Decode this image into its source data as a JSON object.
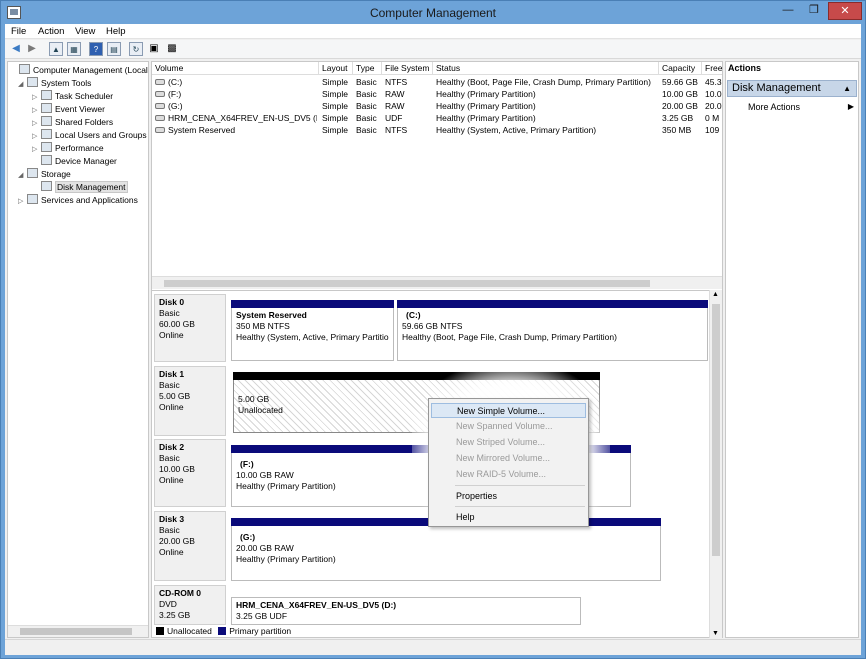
{
  "window": {
    "title": "Computer Management"
  },
  "menubar": [
    "File",
    "Action",
    "View",
    "Help"
  ],
  "tree": [
    {
      "label": "Computer Management (Local",
      "indent": 0,
      "arrow": "",
      "icon": "computer-icon"
    },
    {
      "label": "System Tools",
      "indent": 1,
      "arrow": "◢",
      "icon": "tools-icon"
    },
    {
      "label": "Task Scheduler",
      "indent": 2,
      "arrow": "▷",
      "icon": "clock-icon"
    },
    {
      "label": "Event Viewer",
      "indent": 2,
      "arrow": "▷",
      "icon": "event-viewer-icon"
    },
    {
      "label": "Shared Folders",
      "indent": 2,
      "arrow": "▷",
      "icon": "folder-icon"
    },
    {
      "label": "Local Users and Groups",
      "indent": 2,
      "arrow": "▷",
      "icon": "users-icon"
    },
    {
      "label": "Performance",
      "indent": 2,
      "arrow": "▷",
      "icon": "performance-icon"
    },
    {
      "label": "Device Manager",
      "indent": 2,
      "arrow": "",
      "icon": "device-manager-icon"
    },
    {
      "label": "Storage",
      "indent": 1,
      "arrow": "◢",
      "icon": "storage-icon"
    },
    {
      "label": "Disk Management",
      "indent": 2,
      "arrow": "",
      "icon": "disk-icon",
      "selected": true
    },
    {
      "label": "Services and Applications",
      "indent": 1,
      "arrow": "▷",
      "icon": "services-icon"
    }
  ],
  "volume_list": {
    "columns": [
      "Volume",
      "Layout",
      "Type",
      "File System",
      "Status",
      "Capacity",
      "Free"
    ],
    "rows": [
      [
        "(C:)",
        "Simple",
        "Basic",
        "NTFS",
        "Healthy (Boot, Page File, Crash Dump, Primary Partition)",
        "59.66 GB",
        "45.3"
      ],
      [
        "(F:)",
        "Simple",
        "Basic",
        "RAW",
        "Healthy (Primary Partition)",
        "10.00 GB",
        "10.0"
      ],
      [
        "(G:)",
        "Simple",
        "Basic",
        "RAW",
        "Healthy (Primary Partition)",
        "20.00 GB",
        "20.0"
      ],
      [
        "HRM_CENA_X64FREV_EN-US_DV5 (D:)",
        "Simple",
        "Basic",
        "UDF",
        "Healthy (Primary Partition)",
        "3.25 GB",
        "0 M"
      ],
      [
        "System Reserved",
        "Simple",
        "Basic",
        "NTFS",
        "Healthy (System, Active, Primary Partition)",
        "350 MB",
        "109"
      ]
    ]
  },
  "disks": [
    {
      "name": "Disk 0",
      "type": "Basic",
      "size": "60.00 GB",
      "state": "Online",
      "partitions": [
        {
          "name": "System Reserved",
          "line2": "350 MB NTFS",
          "line3": "Healthy (System, Active, Primary Partitio"
        },
        {
          "name": "(C:)",
          "line2": "59.66 GB NTFS",
          "line3": "Healthy (Boot, Page File, Crash Dump, Primary Partition)"
        }
      ]
    },
    {
      "name": "Disk 1",
      "type": "Basic",
      "size": "5.00 GB",
      "state": "Online",
      "partitions": [
        {
          "name": "",
          "line2": "5.00 GB",
          "line3": "Unallocated"
        }
      ]
    },
    {
      "name": "Disk 2",
      "type": "Basic",
      "size": "10.00 GB",
      "state": "Online",
      "partitions": [
        {
          "name": "(F:)",
          "line2": "10.00 GB RAW",
          "line3": "Healthy (Primary Partition)"
        }
      ]
    },
    {
      "name": "Disk 3",
      "type": "Basic",
      "size": "20.00 GB",
      "state": "Online",
      "partitions": [
        {
          "name": "(G:)",
          "line2": "20.00 GB RAW",
          "line3": "Healthy (Primary Partition)"
        }
      ]
    },
    {
      "name": "CD-ROM 0",
      "type": "DVD",
      "size": "3.25 GB",
      "state": "",
      "partitions": [
        {
          "name": "HRM_CENA_X64FREV_EN-US_DV5 (D:)",
          "line2": "3.25 GB UDF",
          "line3": ""
        }
      ]
    }
  ],
  "legend": {
    "unallocated": "Unallocated",
    "primary": "Primary partition"
  },
  "actions": {
    "header": "Actions",
    "section": "Disk Management",
    "item": "More Actions"
  },
  "context_menu": [
    {
      "label": "New Simple Volume...",
      "state": "highlight"
    },
    {
      "label": "New Spanned Volume...",
      "state": "disabled"
    },
    {
      "label": "New Striped Volume...",
      "state": "disabled"
    },
    {
      "label": "New Mirrored Volume...",
      "state": "disabled"
    },
    {
      "label": "New RAID-5 Volume...",
      "state": "disabled"
    },
    {
      "label": "Properties",
      "state": "normal"
    },
    {
      "label": "Help",
      "state": "normal"
    }
  ],
  "colors": {
    "primary_partition": "#0a0a7a",
    "unallocated": "#000000",
    "titlebar": "#6da3d8"
  }
}
